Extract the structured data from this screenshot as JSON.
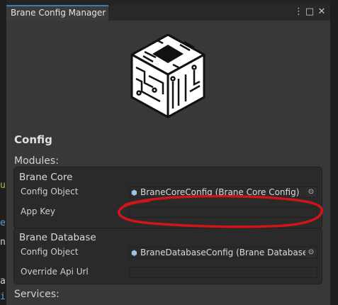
{
  "window": {
    "title": "Brane Config Manager",
    "menu_glyph": "⋮",
    "maximize_glyph": "□",
    "close_glyph": "✕"
  },
  "logo": {
    "icon": "brane-cube-logo"
  },
  "config_heading": "Config",
  "modules_heading": "Modules:",
  "services_heading": "Services:",
  "modules": [
    {
      "title": "Brane Core",
      "config_object_label": "Config Object",
      "config_object_value": "BraneCoreConfig (Brane Core Config)",
      "extra_label": "App Key",
      "extra_value": ""
    },
    {
      "title": "Brane Database",
      "config_object_label": "Config Object",
      "config_object_value": "BraneDatabaseConfig (Brane Database C",
      "extra_label": "Override Api Url",
      "extra_value": ""
    }
  ],
  "background_code": [
    "u",
    "e",
    "n",
    "a",
    "i"
  ],
  "annotation": {
    "color": "#d0141a"
  }
}
